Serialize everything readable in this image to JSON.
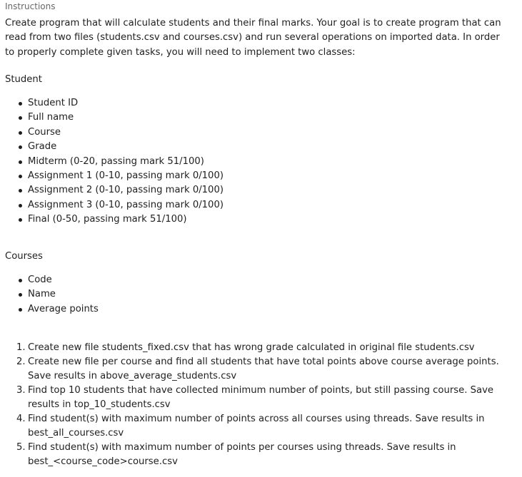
{
  "header": {
    "title": "Instructions"
  },
  "intro": "Create program that will calculate students and their final marks. Your goal is to create program that can read from two files (students.csv and courses.csv) and run several operations on imported data. In order to properly complete given tasks, you will need to implement two classes:",
  "student": {
    "title": "Student",
    "fields": [
      "Student ID",
      "Full name",
      "Course",
      "Grade",
      "Midterm (0-20, passing mark 51/100)",
      "Assignment 1 (0-10, passing mark 0/100)",
      "Assignment 2 (0-10, passing mark 0/100)",
      "Assignment 3 (0-10, passing mark 0/100)",
      "Final (0-50, passing mark 51/100)"
    ]
  },
  "courses": {
    "title": "Courses",
    "fields": [
      "Code",
      "Name",
      "Average points"
    ]
  },
  "tasks": [
    {
      "num": "1.",
      "text": "Create new file students_fixed.csv that has wrong grade calculated in original file students.csv"
    },
    {
      "num": "2.",
      "text": "Create new file per course and find all students that have total points above course average points. Save results in above_average_students.csv"
    },
    {
      "num": "3.",
      "text": "Find top 10 students that have collected minimum number of points, but still passing course. Save results in top_10_students.csv"
    },
    {
      "num": "4.",
      "text": "Find student(s) with maximum number of points across all courses using threads. Save results in best_all_courses.csv"
    },
    {
      "num": "5.",
      "text": "Find student(s) with maximum number of points per courses using threads. Save results in best_<course_code>course.csv"
    }
  ]
}
